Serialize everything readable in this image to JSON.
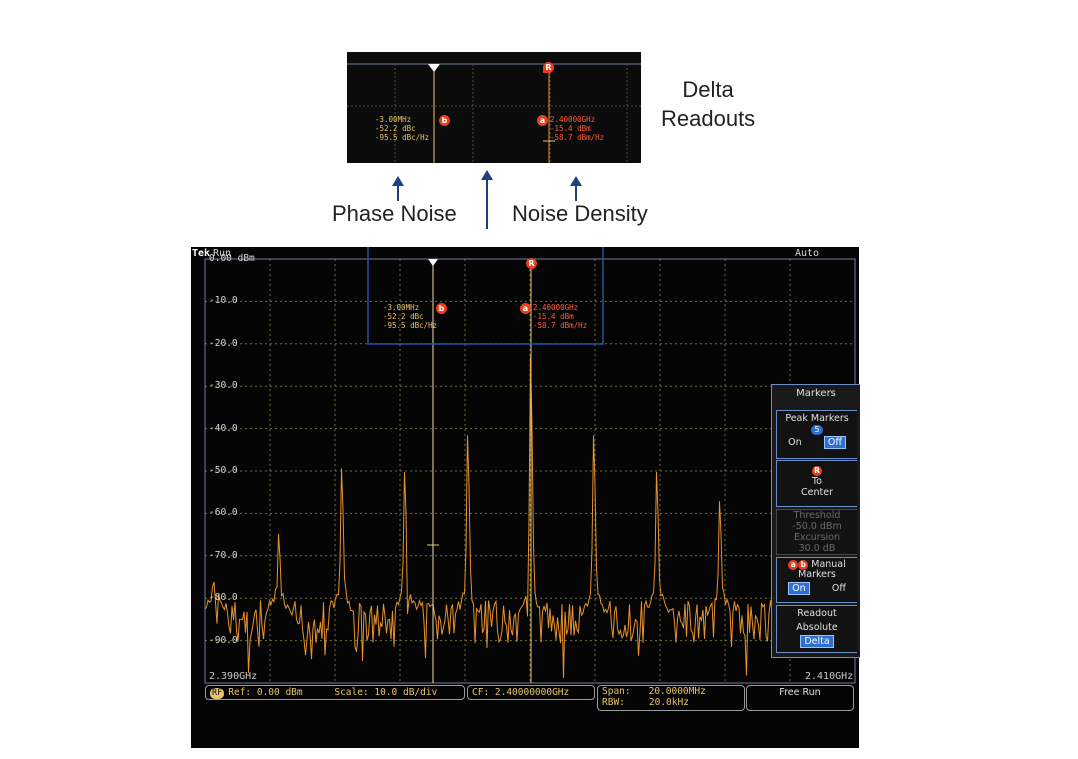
{
  "callouts": {
    "delta_readouts": "Delta\nReadouts",
    "phase_noise": "Phase Noise",
    "noise_density": "Noise Density"
  },
  "inset": {
    "left_readout": "-3.00MHz\n-52.2 dBc\n-95.5 dBc/Hz",
    "right_readout": "2.40000GHz\n-15.4 dBm\n-58.7 dBm/Hz",
    "marker_b": "b",
    "marker_a": "a",
    "marker_r": "R"
  },
  "scope": {
    "brand": "Tek",
    "state": "Run",
    "mode": "Auto",
    "y_labels": [
      "0.00 dBm",
      "-10.0",
      "-20.0",
      "-30.0",
      "-40.0",
      "-50.0",
      "-60.0",
      "-70.0",
      "-80.0",
      "-90.0"
    ],
    "x_start": "2.390GHz",
    "x_end": "2.410GHz",
    "readout_left": "-3.00MHz\n-52.2 dBc\n-95.5 dBc/Hz",
    "readout_right": "2.40000GHz\n-15.4 dBm\n-58.7 dBm/Hz",
    "marker_b": "b",
    "marker_a": "a",
    "marker_r": "R"
  },
  "status": {
    "rf_badge": "RF",
    "ref": "Ref: 0.00 dBm",
    "scale": "Scale: 10.0 dB/div",
    "cf": "CF: 2.40000000GHz",
    "span_label": "Span:",
    "span_value": "20.0000MHz",
    "rbw_label": "RBW:",
    "rbw_value": "20.0kHz",
    "trigger": "Free Run"
  },
  "menu": {
    "title": "Markers",
    "peak_markers": "Peak Markers",
    "peak_count": "5",
    "on": "On",
    "off": "Off",
    "r_icon": "R",
    "to_center": "To\nCenter",
    "threshold": "Threshold",
    "threshold_value": "-50.0 dBm",
    "excursion": "Excursion",
    "excursion_value": "30.0 dB",
    "ab_icon_a": "a",
    "ab_icon_b": "b",
    "manual": "Manual",
    "markers": "Markers",
    "readout": "Readout",
    "absolute": "Absolute",
    "delta": "Delta"
  },
  "colors": {
    "trace": "#e8922e",
    "grid": "#6f6f3f",
    "marker": "#e8401e",
    "menu_accent": "#2e6fd0",
    "callout_box": "#1f3f7f"
  }
}
